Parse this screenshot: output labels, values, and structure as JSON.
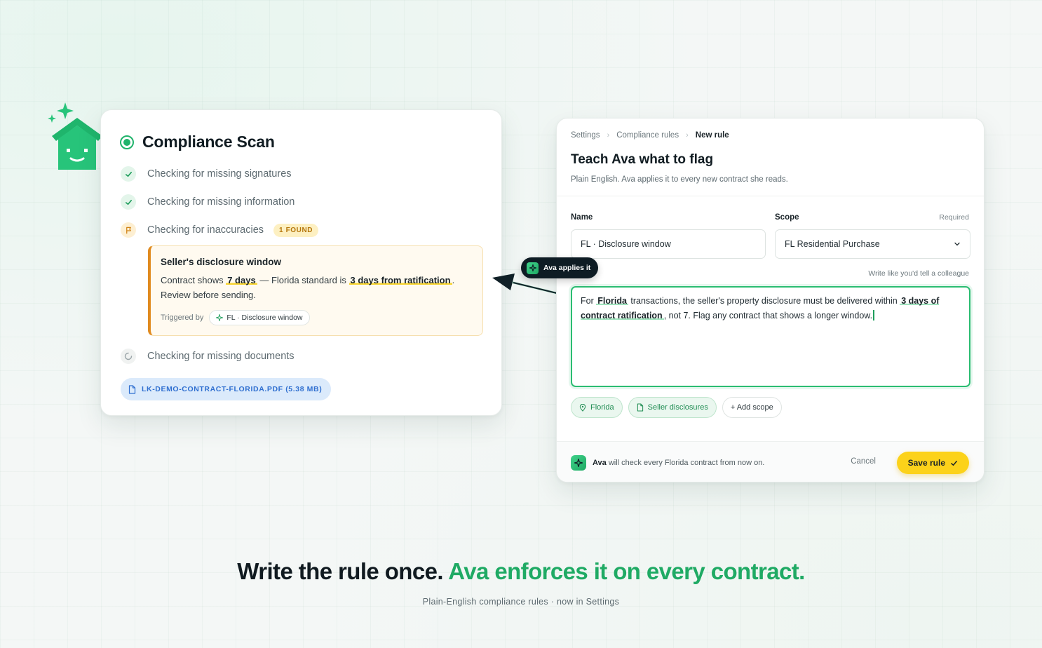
{
  "scan": {
    "title": "Compliance Scan",
    "items": [
      {
        "label": "Checking for missing signatures"
      },
      {
        "label": "Checking for missing information"
      },
      {
        "label": "Checking for inaccuracies",
        "badge": "1 FOUND"
      },
      {
        "label": "Checking for missing documents"
      }
    ],
    "finding": {
      "title": "Seller's disclosure window",
      "text_1": "Contract shows",
      "hl_1": "7 days",
      "text_2": "— Florida standard is",
      "hl_2": "3 days from ratification",
      "text_3": ".",
      "text_4": "Review before sending.",
      "trigger_label": "Triggered by",
      "trigger_chip": "FL · Disclosure window"
    },
    "file": "LK-DEMO-CONTRACT-FLORIDA.PDF (5.38 MB)"
  },
  "rule": {
    "breadcrumb": [
      "Settings",
      "Compliance rules",
      "New rule"
    ],
    "title": "Teach Ava what to flag",
    "subtitle": "Plain English. Ava applies it to every new contract she reads.",
    "name_label": "Name",
    "scope_label": "Scope",
    "required": "Required",
    "name_value": "FL · Disclosure window",
    "scope_value": "FL Residential Purchase",
    "hint": "Write like you'd tell a colleague",
    "text": {
      "t1": "For",
      "h1": "Florida",
      "t2": "transactions, the seller's property disclosure must be delivered within",
      "h2": "3 days of contract ratification",
      "t3": ", not 7. Flag any contract that shows a longer window."
    },
    "tags": [
      "Florida",
      "Seller disclosures",
      "+ Add scope"
    ],
    "footer": {
      "ava": "Ava",
      "text": "will check every Florida contract from now on.",
      "cancel": "Cancel",
      "save": "Save rule"
    }
  },
  "connector": {
    "pill": "Ava applies it"
  },
  "hero": {
    "headline_1": "Write the rule once.",
    "headline_2": "Ava enforces it on every contract.",
    "subline": "Plain-English compliance rules · now in Settings"
  },
  "colors": {
    "brand_green": "#1faa64",
    "warning": "#e08a1e",
    "save": "#fcd21a",
    "dark": "#0e1c24"
  }
}
